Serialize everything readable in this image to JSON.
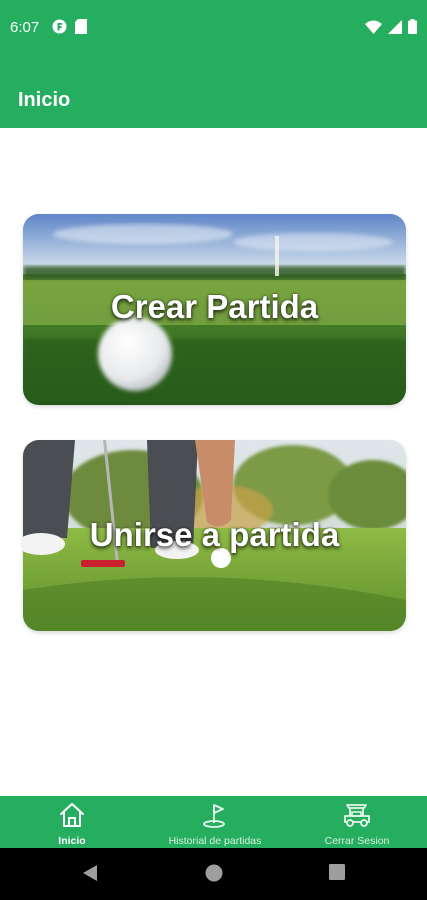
{
  "status_bar": {
    "time": "6:07",
    "left_icons": [
      "badge-f-icon",
      "sd-card-icon"
    ],
    "right_icons": [
      "wifi-icon",
      "cell-signal-icon",
      "battery-icon"
    ]
  },
  "app_bar": {
    "title": "Inicio"
  },
  "cards": [
    {
      "label": "Crear Partida",
      "image": "golf-ball-on-grass-image"
    },
    {
      "label": "Unirse a partida",
      "image": "golfer-putting-image"
    }
  ],
  "bottom_nav": {
    "items": [
      {
        "label": "Inicio",
        "icon": "home-icon",
        "active": true
      },
      {
        "label": "Historial de partidas",
        "icon": "golf-flag-icon",
        "active": false
      },
      {
        "label": "Cerrar Sesion",
        "icon": "golf-cart-icon",
        "active": false
      }
    ]
  },
  "system_nav": {
    "buttons": [
      "back-icon",
      "home-circle-icon",
      "recents-icon"
    ]
  },
  "colors": {
    "primary": "#25ae5f",
    "nav_inactive_text": "#d6efdf",
    "system_bar": "#000000"
  }
}
